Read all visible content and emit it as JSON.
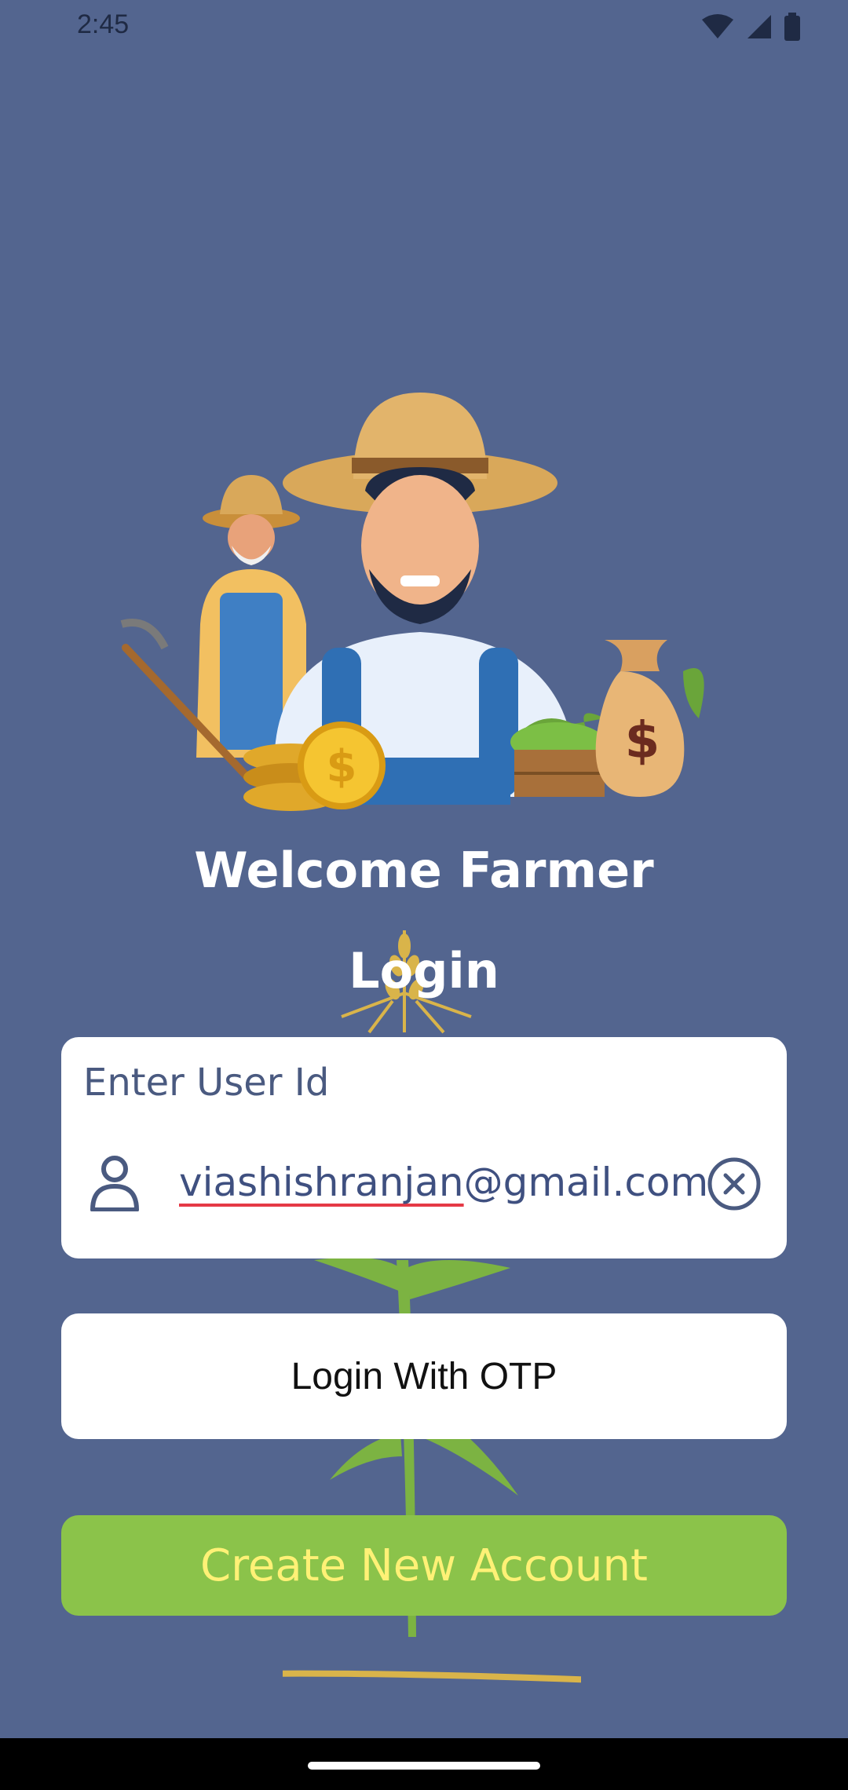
{
  "status_bar": {
    "time": "2:45",
    "icons": [
      "wifi-icon",
      "signal-icon",
      "battery-icon"
    ]
  },
  "hero": {
    "illustration": "farmers-with-coins-and-money-bag"
  },
  "welcome_title": "Welcome Farmer",
  "login_title": "Login",
  "user_field": {
    "label": "Enter User Id",
    "value_underlined": "viashishranjan",
    "value_rest": "@gmail.com",
    "leading_icon": "person-icon",
    "trailing_icon": "clear-icon"
  },
  "otp_button_label": "Login With OTP",
  "create_account_label": "Create New Account",
  "colors": {
    "background": "#53658f",
    "card": "#ffffff",
    "create_button": "#8bc34a",
    "create_text": "#fff176",
    "spell_underline": "#e53946"
  }
}
